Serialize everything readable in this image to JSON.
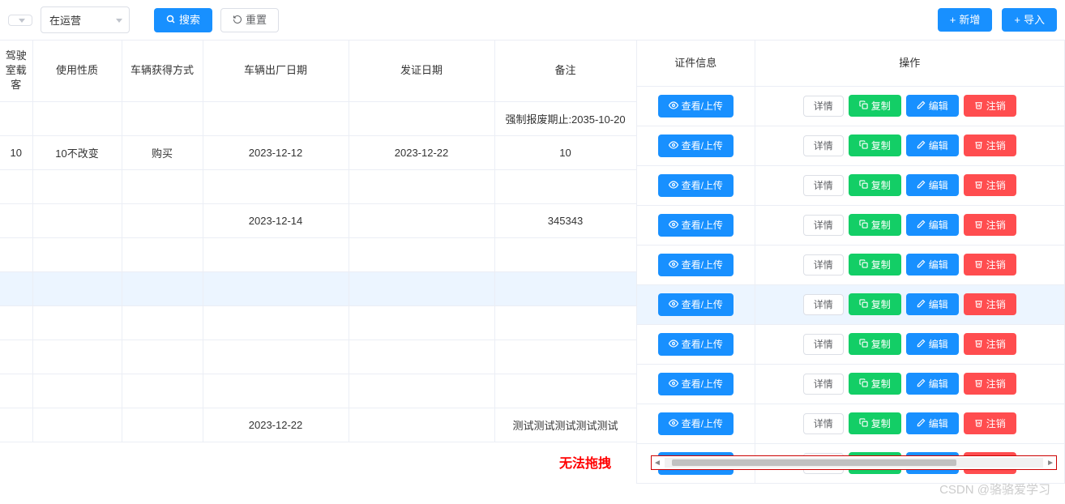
{
  "toolbar": {
    "select1": "",
    "select2": "在运营",
    "search_label": "搜索",
    "reset_label": "重置",
    "add_label": "新增",
    "import_label": "导入"
  },
  "headers_left": {
    "cab_passengers": "驾驶室载客",
    "usage_nature": "使用性质",
    "acquisition_method": "车辆获得方式",
    "factory_date": "车辆出厂日期",
    "issue_date": "发证日期",
    "remarks": "备注"
  },
  "headers_right": {
    "cert_info": "证件信息",
    "operations": "操作"
  },
  "buttons": {
    "view_upload": "查看/上传",
    "details": "详情",
    "copy": "复制",
    "edit": "编辑",
    "cancel": "注销"
  },
  "rows": [
    {
      "cab": "",
      "usage": "",
      "acq": "",
      "factory": "",
      "issue": "",
      "remarks": "强制报废期止:2035-10-20",
      "hover": false
    },
    {
      "cab": "10",
      "usage": "10不改变",
      "acq": "购买",
      "factory": "2023-12-12",
      "issue": "2023-12-22",
      "remarks": "10",
      "hover": false
    },
    {
      "cab": "",
      "usage": "",
      "acq": "",
      "factory": "",
      "issue": "",
      "remarks": "",
      "hover": false
    },
    {
      "cab": "",
      "usage": "",
      "acq": "",
      "factory": "2023-12-14",
      "issue": "",
      "remarks": "345343",
      "hover": false
    },
    {
      "cab": "",
      "usage": "",
      "acq": "",
      "factory": "",
      "issue": "",
      "remarks": "",
      "hover": false
    },
    {
      "cab": "",
      "usage": "",
      "acq": "",
      "factory": "",
      "issue": "",
      "remarks": "",
      "hover": true
    },
    {
      "cab": "",
      "usage": "",
      "acq": "",
      "factory": "",
      "issue": "",
      "remarks": "",
      "hover": false
    },
    {
      "cab": "",
      "usage": "",
      "acq": "",
      "factory": "",
      "issue": "",
      "remarks": "",
      "hover": false
    },
    {
      "cab": "",
      "usage": "",
      "acq": "",
      "factory": "",
      "issue": "",
      "remarks": "",
      "hover": false
    },
    {
      "cab": "",
      "usage": "",
      "acq": "",
      "factory": "2023-12-22",
      "issue": "",
      "remarks": "测试测试测试测试测试",
      "hover": false
    }
  ],
  "annotation": "无法拖拽",
  "watermark": "CSDN @骆骆爱学习"
}
